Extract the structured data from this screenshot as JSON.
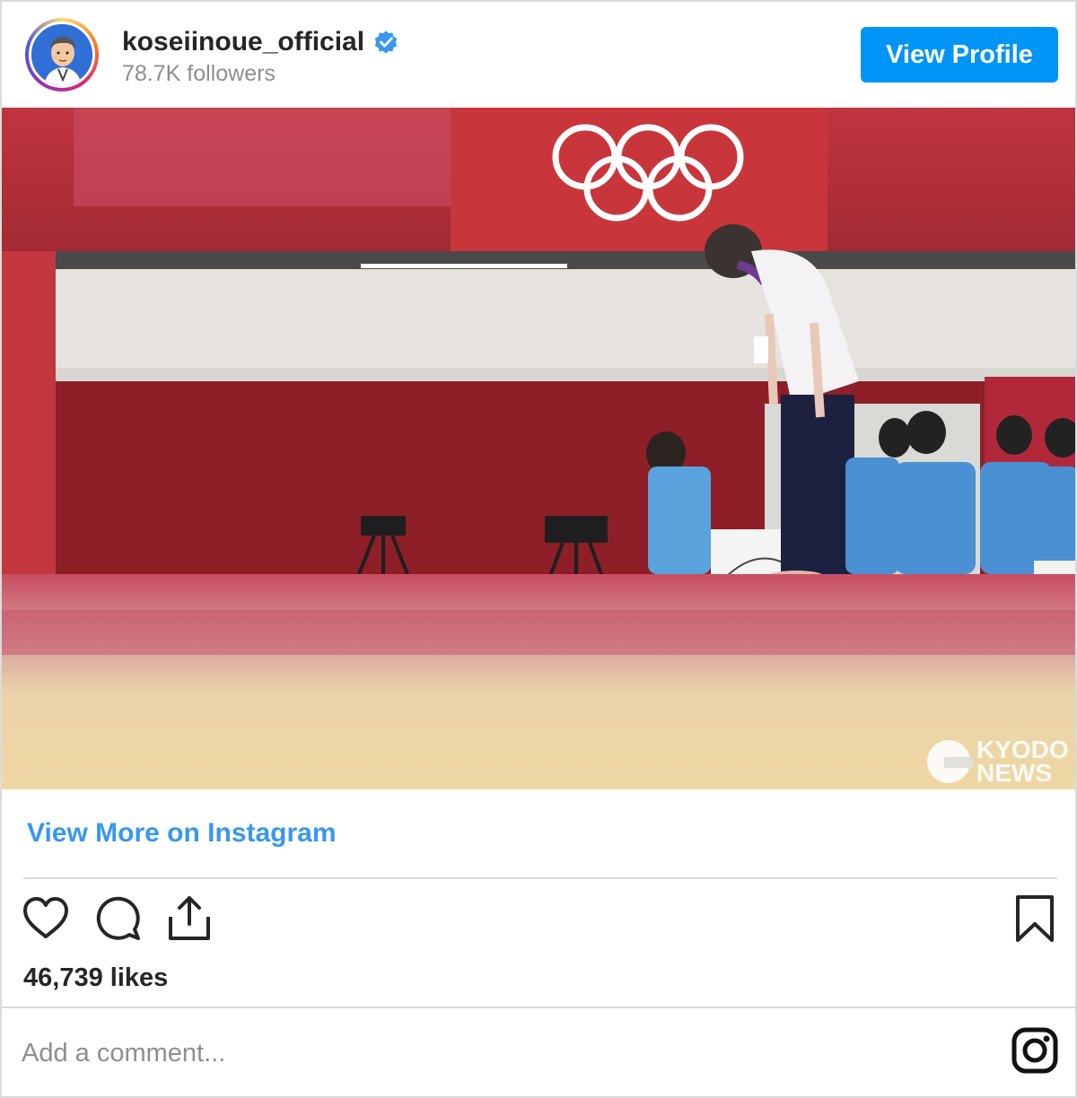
{
  "header": {
    "username": "koseiinoue_official",
    "verified": true,
    "followers": "78.7K followers",
    "view_profile_label": "View Profile"
  },
  "post": {
    "photo_description_icons": [
      "olympic-rings-icon"
    ],
    "watermark_line1": "KYODO",
    "watermark_line2": "NEWS",
    "view_more_label": "View More on Instagram",
    "likes": "46,739 likes",
    "comment_placeholder": "Add a comment..."
  },
  "actions": {
    "icons": [
      "heart-icon",
      "comment-icon",
      "share-icon",
      "bookmark-icon",
      "instagram-icon"
    ]
  },
  "colors": {
    "accent": "#0095f6",
    "link": "#3897f0",
    "muted": "#8e8e8e",
    "text": "#262626",
    "border": "#dbdbdb"
  }
}
